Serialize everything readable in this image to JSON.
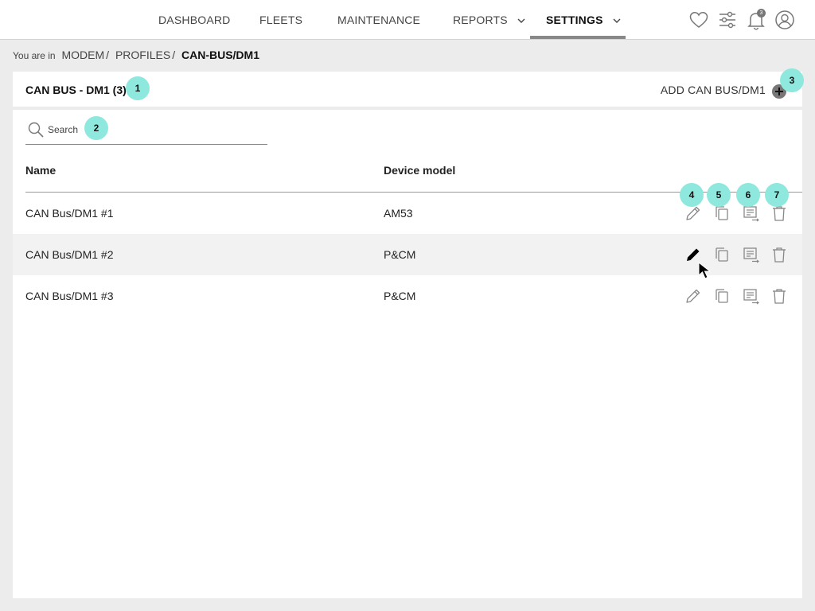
{
  "nav": {
    "items": [
      {
        "label": "DASHBOARD"
      },
      {
        "label": "FLEETS"
      },
      {
        "label": "MAINTENANCE"
      },
      {
        "label": "REPORTS"
      },
      {
        "label": "SETTINGS"
      }
    ],
    "active": "SETTINGS",
    "notification_count": "3",
    "icons": [
      "heart-icon",
      "sliders-icon",
      "bell-icon",
      "user-icon"
    ]
  },
  "breadcrumb": {
    "prefix": "You are in",
    "items": [
      "MODEM",
      "PROFILES"
    ],
    "separator": "/",
    "current": "CAN-BUS/DM1"
  },
  "card": {
    "title": "CAN BUS - DM1 (3)",
    "add_label": "ADD CAN BUS/DM1"
  },
  "search": {
    "placeholder": "Search",
    "value": ""
  },
  "table": {
    "columns": [
      "Name",
      "Device model"
    ],
    "rows": [
      {
        "name": "CAN Bus/DM1 #1",
        "device_model": "AM53"
      },
      {
        "name": "CAN Bus/DM1 #2",
        "device_model": "P&CM"
      },
      {
        "name": "CAN Bus/DM1 #3",
        "device_model": "P&CM"
      }
    ],
    "row_actions": [
      "edit-icon",
      "copy-icon",
      "details-icon",
      "delete-icon"
    ],
    "hovered_row": 2
  },
  "markers": [
    "1",
    "2",
    "3",
    "4",
    "5",
    "6",
    "7"
  ],
  "colors": {
    "marker": "#8ee8de",
    "nav_underline": "#888888",
    "hover_row": "#f2f2f2",
    "background": "#ececec"
  }
}
